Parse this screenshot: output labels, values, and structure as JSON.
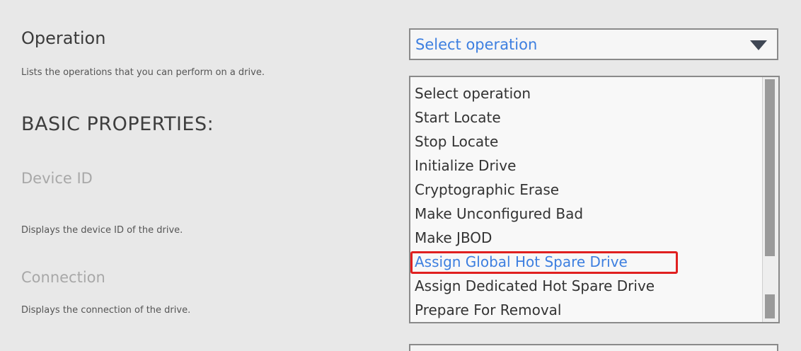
{
  "operation": {
    "label": "Operation",
    "description": "Lists the operations that you can perform on a drive.",
    "selected_value": "Select operation",
    "options": [
      "Select operation",
      "Start Locate",
      "Stop Locate",
      "Initialize Drive",
      "Cryptographic Erase",
      "Make Unconfigured Bad",
      "Make JBOD",
      "Assign Global Hot Spare Drive",
      "Assign Dedicated Hot Spare Drive",
      "Prepare For Removal"
    ],
    "highlighted_option": "Assign Global Hot Spare Drive"
  },
  "basic_properties": {
    "heading": "BASIC PROPERTIES:",
    "device_id": {
      "label": "Device ID",
      "description": "Displays the device ID of the drive."
    },
    "connection": {
      "label": "Connection",
      "description": "Displays the connection of the drive."
    }
  },
  "colors": {
    "link_blue": "#3d7fe0",
    "highlight_red": "#e02020"
  },
  "icons": {
    "dropdown_arrow": "triangle-down-icon"
  }
}
